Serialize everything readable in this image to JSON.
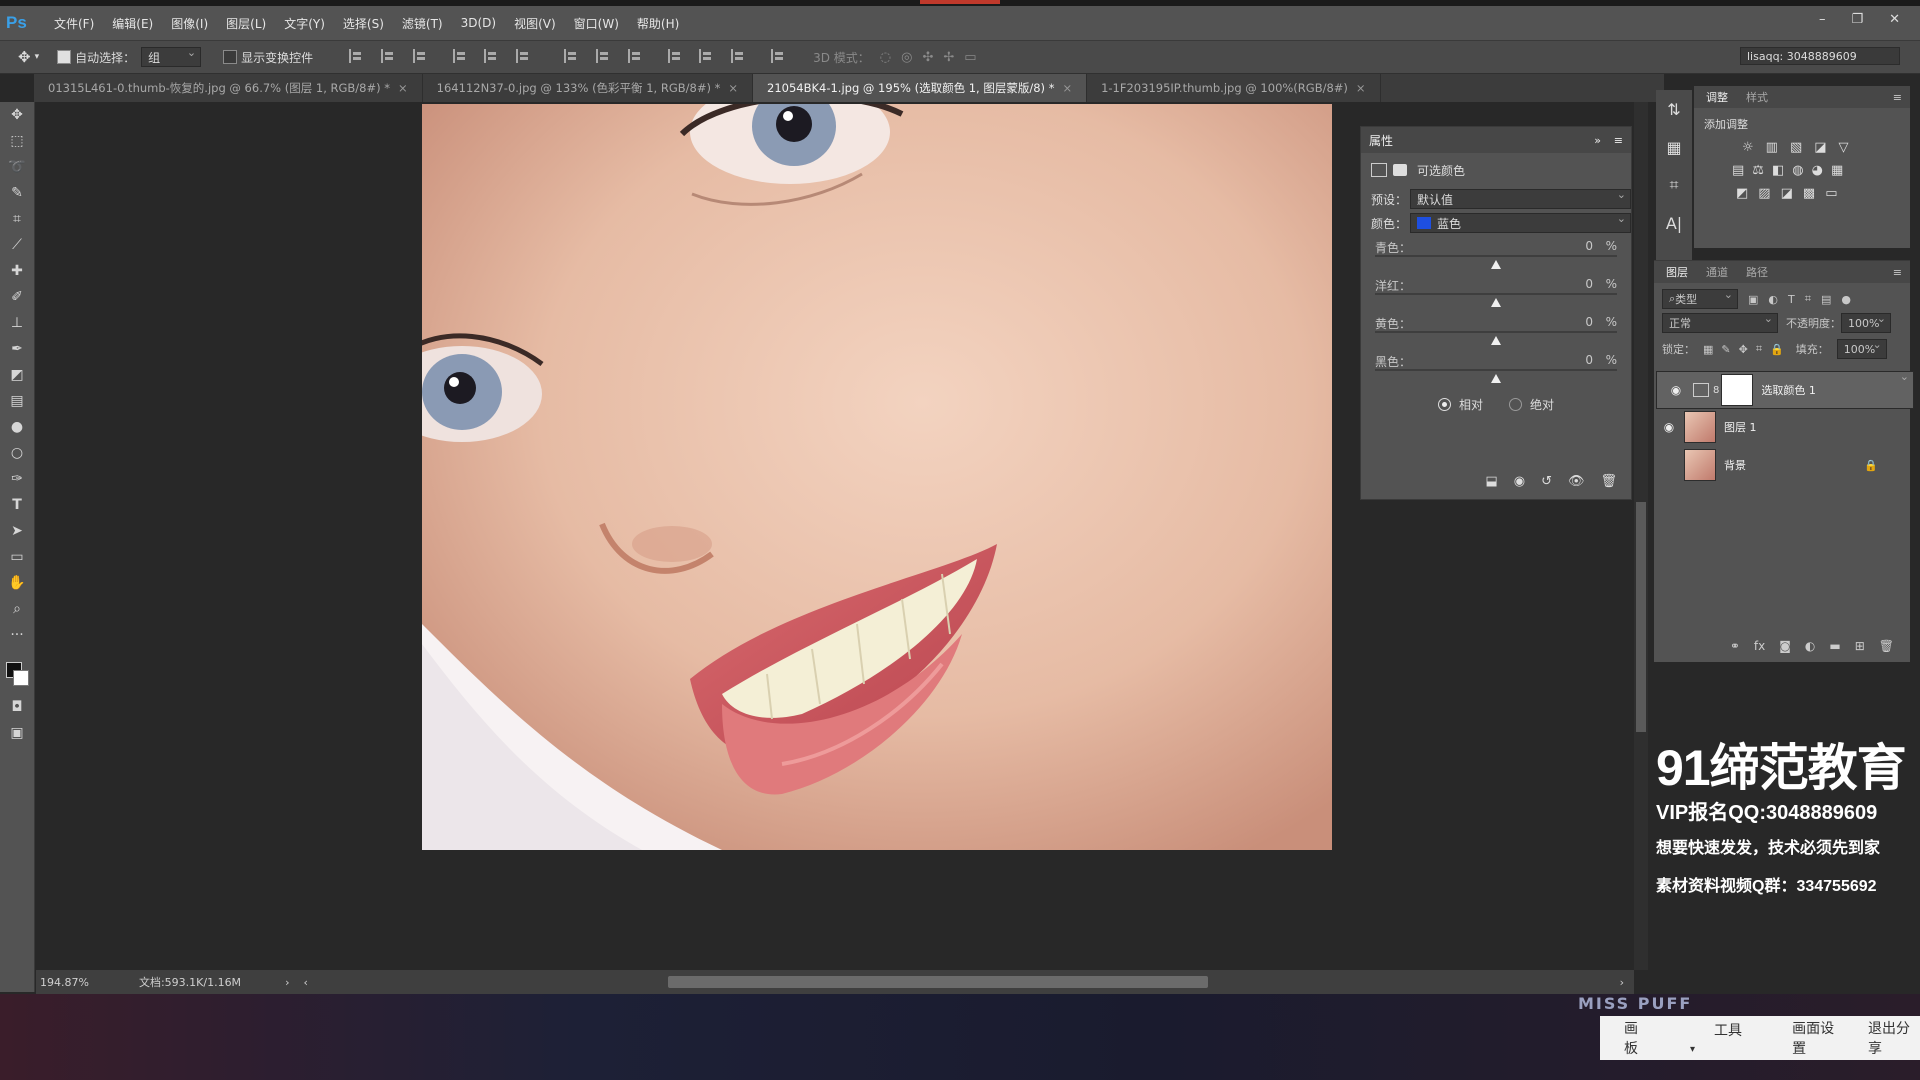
{
  "app": {
    "logo": "Ps"
  },
  "menu": [
    "文件(F)",
    "编辑(E)",
    "图像(I)",
    "图层(L)",
    "文字(Y)",
    "选择(S)",
    "滤镜(T)",
    "3D(D)",
    "视图(V)",
    "窗口(W)",
    "帮助(H)"
  ],
  "window_controls": {
    "minimize": "–",
    "restore": "❐",
    "close": "✕"
  },
  "options": {
    "auto_select_label": "自动选择：",
    "auto_select_value": "组",
    "show_transform_label": "显示变换控件",
    "mode_3d_label": "3D 模式：",
    "user": "lisaqq: 3048889609"
  },
  "tabs": [
    {
      "label": "01315L461-0.thumb-恢复的.jpg @ 66.7% (图层 1, RGB/8#) *",
      "active": false
    },
    {
      "label": "164112N37-0.jpg @ 133% (色彩平衡 1, RGB/8#) *",
      "active": false
    },
    {
      "label": "21054BK4-1.jpg @ 195% (选取颜色 1, 图层蒙版/8) *",
      "active": true
    },
    {
      "label": "1-1F203195IP.thumb.jpg @ 100%(RGB/8#)",
      "active": false
    }
  ],
  "status": {
    "zoom": "194.87%",
    "doc": "文档:593.1K/1.16M"
  },
  "properties": {
    "title": "属性",
    "type": "可选颜色",
    "preset_label": "预设：",
    "preset_value": "默认值",
    "color_label": "颜色：",
    "color_value": "蓝色",
    "color_swatch": "#1e4fe0",
    "sliders": [
      {
        "label": "青色：",
        "value": "0",
        "unit": "%",
        "level": 0.5
      },
      {
        "label": "洋红：",
        "value": "0",
        "unit": "%",
        "level": 0.5
      },
      {
        "label": "黄色：",
        "value": "0",
        "unit": "%",
        "level": 0.5
      },
      {
        "label": "黑色：",
        "value": "0",
        "unit": "%",
        "level": 0.5
      }
    ],
    "relative": "相对",
    "absolute": "绝对"
  },
  "adjustments": {
    "tab1": "调整",
    "tab2": "样式",
    "add_label": "添加调整"
  },
  "layers": {
    "tabs": [
      "图层",
      "通道",
      "路径"
    ],
    "filter": "类型",
    "blend": "正常",
    "opacity_label": "不透明度：",
    "opacity": "100%",
    "lock_label": "锁定：",
    "fill_label": "填充：",
    "fill": "100%",
    "items": [
      {
        "name": "选取颜色 1",
        "visible": true,
        "selected": true
      },
      {
        "name": "图层 1",
        "visible": true,
        "selected": false
      },
      {
        "name": "背景",
        "visible": false,
        "selected": false
      }
    ]
  },
  "promo": {
    "brand": "91缔范教育",
    "vip": "VIP报名QQ:3048889609",
    "slogan": "想要快速发发，技术必须先到家",
    "group": "素材资料视频Q群：334755692"
  },
  "bottom": {
    "banner": "MISS PUFF",
    "buttons": [
      "画板",
      "工具",
      "画面设置",
      "退出分享"
    ]
  }
}
